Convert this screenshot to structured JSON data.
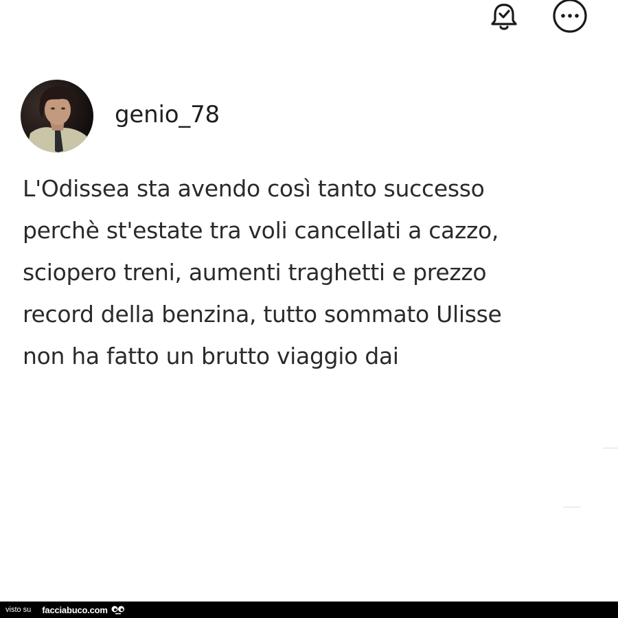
{
  "header": {
    "icons": {
      "notify": "bell-check-icon",
      "more": "more-options-icon"
    },
    "icon_color": "#1a1a1a"
  },
  "post": {
    "username": "genio_78",
    "text": "L'Odissea sta avendo così tanto successo\nperchè st'estate tra voli cancellati a cazzo,\nsciopero treni, aumenti traghetti e prezzo\nrecord della benzina, tutto sommato Ulisse\nnon ha fatto un brutto viaggio dai"
  },
  "watermark": {
    "prefix": "visto su",
    "site": "facciabuco.com",
    "background": "#000000"
  }
}
